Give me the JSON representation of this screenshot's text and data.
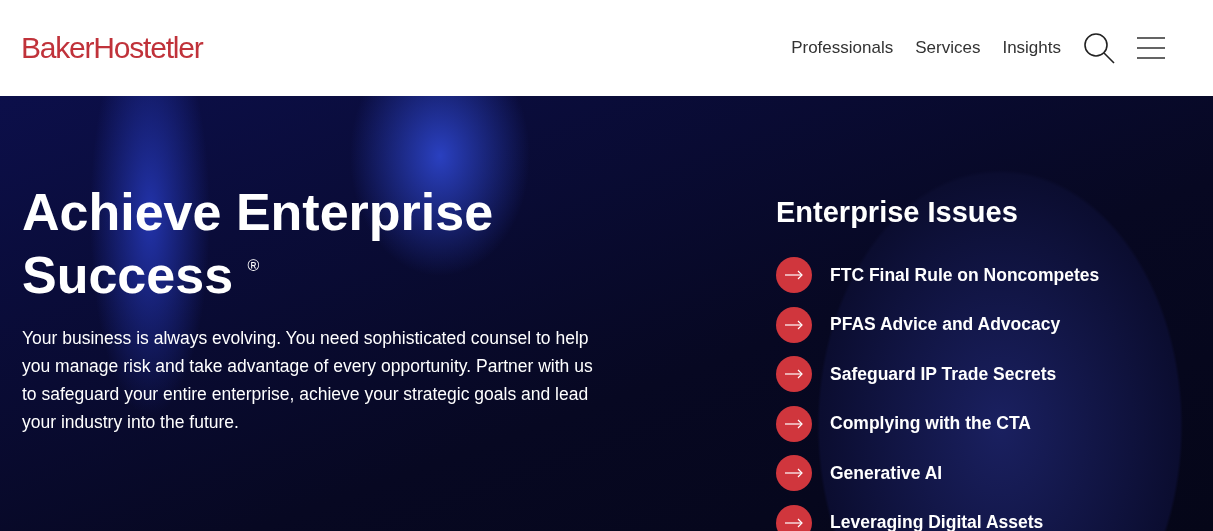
{
  "header": {
    "logo": "BakerHostetler",
    "nav": [
      {
        "label": "Professionals"
      },
      {
        "label": "Services"
      },
      {
        "label": "Insights"
      }
    ]
  },
  "hero": {
    "title": "Achieve Enterprise Success $^{®}$",
    "body": "Your business is always evolving. You need sophisticated counsel to help you manage risk and take advantage of every opportunity. Partner with us to safeguard your entire enterprise, achieve your strategic goals and lead your industry into the future."
  },
  "issues": {
    "title": "Enterprise Issues",
    "items": [
      {
        "label": "FTC Final Rule on Noncompetes"
      },
      {
        "label": "PFAS Advice and Advocacy"
      },
      {
        "label": "Safeguard IP Trade Secrets"
      },
      {
        "label": "Complying with the CTA"
      },
      {
        "label": "Generative AI"
      },
      {
        "label": "Leveraging Digital Assets"
      }
    ]
  }
}
